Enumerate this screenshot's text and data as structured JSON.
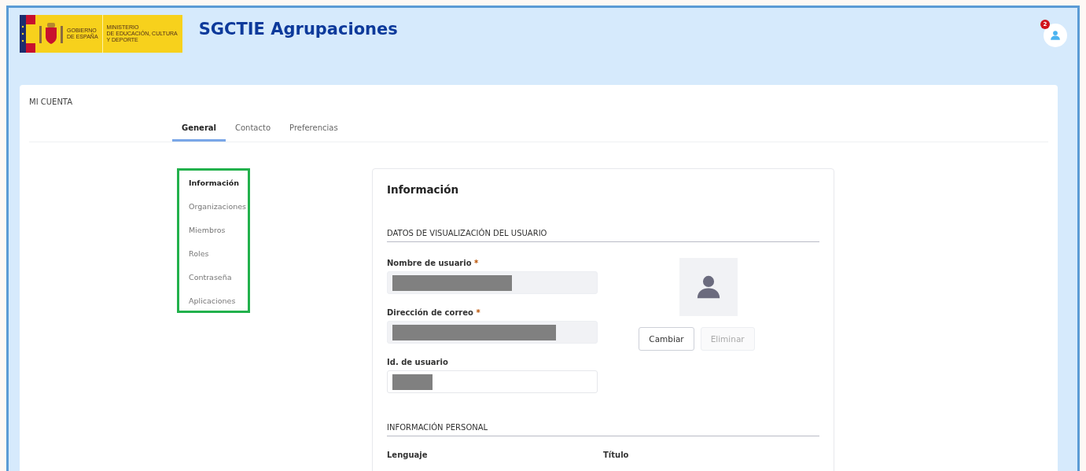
{
  "header": {
    "logo": {
      "line_1": "GOBIERNO",
      "line_2": "DE ESPAÑA",
      "ministry_1": "MINISTERIO",
      "ministry_2": "DE EDUCACIÓN, CULTURA",
      "ministry_3": "Y DEPORTE"
    },
    "title": "SGCTIE Agrupaciones",
    "notification_count": "2"
  },
  "page_title": "MI CUENTA",
  "tabs": [
    {
      "label": "General",
      "selected": true
    },
    {
      "label": "Contacto",
      "selected": false
    },
    {
      "label": "Preferencias",
      "selected": false
    }
  ],
  "side_nav": {
    "highlighted": true,
    "items": [
      {
        "label": "Información",
        "selected": true
      },
      {
        "label": "Organizaciones",
        "selected": false
      },
      {
        "label": "Miembros",
        "selected": false
      },
      {
        "label": "Roles",
        "selected": false
      },
      {
        "label": "Contraseña",
        "selected": false
      },
      {
        "label": "Aplicaciones",
        "selected": false
      }
    ]
  },
  "panel": {
    "title": "Información",
    "sections": [
      {
        "heading": "DATOS DE VISUALIZACIÓN DEL USUARIO"
      },
      {
        "heading": "INFORMACIÓN PERSONAL"
      }
    ],
    "fields": [
      {
        "label": "Nombre de usuario",
        "required_mark": "*",
        "disabled": true,
        "redacted": true
      },
      {
        "label": "Dirección de correo",
        "required_mark": "*",
        "disabled": true,
        "redacted": true
      },
      {
        "label": "Id. de usuario",
        "disabled": false,
        "redacted": true
      }
    ],
    "avatar_buttons": [
      {
        "label": "Cambiar",
        "disabled": false
      },
      {
        "label": "Eliminar",
        "disabled": true
      }
    ],
    "personal_fields": [
      "Lenguaje",
      "Título"
    ]
  }
}
